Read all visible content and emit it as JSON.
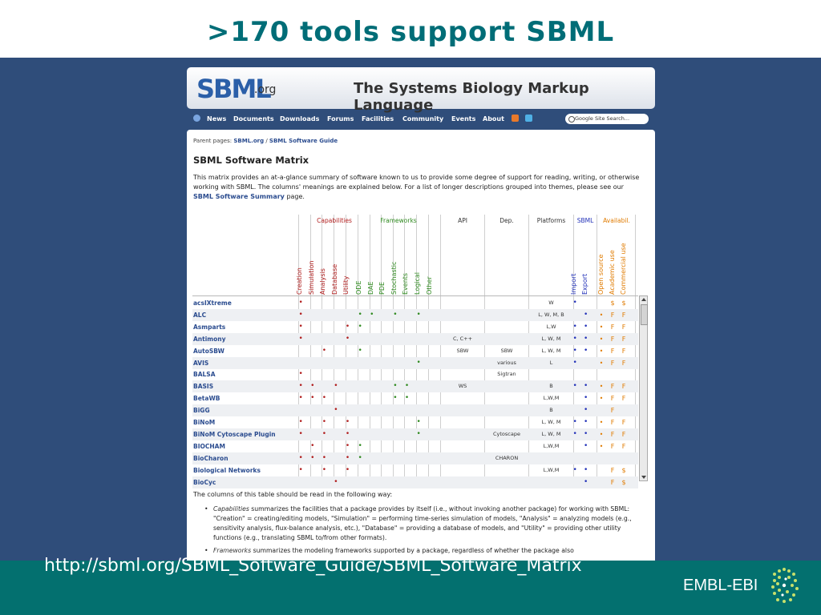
{
  "slide": {
    "title": ">170 tools support SBML",
    "url": "http://sbml.org/SBML_Software_Guide/SBML_Software_Matrix",
    "logo_text": "EMBL-EBI"
  },
  "site": {
    "logo_main": "SBML",
    "logo_suffix": ".org",
    "tagline": "The Systems Biology Markup Language",
    "nav": [
      "News",
      "Documents",
      "Downloads",
      "Forums",
      "Facilities",
      "Community",
      "Events",
      "About"
    ],
    "search_placeholder": "Google Site Search..."
  },
  "page": {
    "crumb_prefix": "Parent pages:",
    "crumb_1": "SBML.org",
    "crumb_sep": "/",
    "crumb_2": "SBML Software Guide",
    "heading": "SBML Software Matrix",
    "intro_1": "This matrix provides an at-a-glance summary of software known to us to provide some degree of support for reading, writing, or otherwise working with SBML. The columns' meanings are explained below. For a list of longer descriptions grouped into themes, please see our",
    "intro_link": "SBML Software Summary",
    "intro_2": "page.",
    "explain": "The columns of this table should be read in the following way:",
    "bullet_1_term": "Capabilities",
    "bullet_1_text": "summarizes the facilities that a package provides by itself (i.e., without invoking another package) for working with SBML: \"Creation\" = creating/editing models, \"Simulation\" = performing time-series simulation of models, \"Analysis\" = analyzing models (e.g., sensitivity analysis, flux-balance analysis, etc.), \"Database\" = providing a database of models, and \"Utility\" = providing other utility functions (e.g., translating SBML to/from other formats).",
    "bullet_2_term": "Frameworks",
    "bullet_2_text": "summarizes the modeling frameworks supported by a package, regardless of whether the package also"
  },
  "matrix": {
    "groups": [
      "Capabilities",
      "Frameworks",
      "API",
      "Dep.",
      "Platforms",
      "SBML",
      "Availabil."
    ],
    "capabilities": [
      "Creation",
      "Simulation",
      "Analysis",
      "Database",
      "Utility"
    ],
    "frameworks": [
      "ODE",
      "DAE",
      "PDE",
      "Stochastic",
      "Events",
      "Logical",
      "Other"
    ],
    "sbml": [
      "Import",
      "Export"
    ],
    "availability": [
      "Open source",
      "Academic use",
      "Commercial use"
    ],
    "colors": {
      "capabilities": "#b01c1c",
      "frameworks": "#2f8a1f",
      "sbml": "#2231b8",
      "availability": "#e07b00",
      "link": "#2b4c8f"
    },
    "rows": [
      {
        "name": "acsIXtreme",
        "cap": [
          1,
          0,
          0,
          0,
          0
        ],
        "fw": [
          0,
          0,
          0,
          0,
          0,
          0,
          0
        ],
        "api": "",
        "dep": "",
        "plat": "W",
        "sbml": [
          1,
          0
        ],
        "avail": [
          "",
          "$",
          "$"
        ]
      },
      {
        "name": "ALC",
        "cap": [
          1,
          0,
          0,
          0,
          0
        ],
        "fw": [
          1,
          1,
          0,
          1,
          0,
          1,
          0
        ],
        "api": "",
        "dep": "",
        "plat": "L, W, M, B",
        "sbml": [
          0,
          1
        ],
        "avail": [
          "•",
          "F",
          "F"
        ]
      },
      {
        "name": "Asmparts",
        "cap": [
          1,
          0,
          0,
          0,
          1
        ],
        "fw": [
          1,
          0,
          0,
          0,
          0,
          0,
          0
        ],
        "api": "",
        "dep": "",
        "plat": "L,W",
        "sbml": [
          1,
          1
        ],
        "avail": [
          "•",
          "F",
          "F"
        ]
      },
      {
        "name": "Antimony",
        "cap": [
          1,
          0,
          0,
          0,
          1
        ],
        "fw": [
          0,
          0,
          0,
          0,
          0,
          0,
          0
        ],
        "api": "C, C++",
        "dep": "",
        "plat": "L, W, M",
        "sbml": [
          1,
          1
        ],
        "avail": [
          "•",
          "F",
          "F"
        ]
      },
      {
        "name": "AutoSBW",
        "cap": [
          0,
          0,
          1,
          0,
          0
        ],
        "fw": [
          1,
          0,
          0,
          0,
          0,
          0,
          0
        ],
        "api": "SBW",
        "dep": "SBW",
        "plat": "L, W, M",
        "sbml": [
          1,
          1
        ],
        "avail": [
          "•",
          "F",
          "F"
        ]
      },
      {
        "name": "AVIS",
        "cap": [
          0,
          0,
          0,
          0,
          0
        ],
        "fw": [
          0,
          0,
          0,
          0,
          0,
          1,
          0
        ],
        "api": "",
        "dep": "various",
        "plat": "L",
        "sbml": [
          1,
          0
        ],
        "avail": [
          "•",
          "F",
          "F"
        ]
      },
      {
        "name": "BALSA",
        "cap": [
          1,
          0,
          0,
          0,
          0
        ],
        "fw": [
          0,
          0,
          0,
          0,
          0,
          0,
          0
        ],
        "api": "",
        "dep": "Sigtran",
        "plat": "",
        "sbml": [
          0,
          0
        ],
        "avail": [
          "",
          "",
          ""
        ]
      },
      {
        "name": "BASIS",
        "cap": [
          1,
          1,
          0,
          1,
          0
        ],
        "fw": [
          0,
          0,
          0,
          1,
          1,
          0,
          0
        ],
        "api": "WS",
        "dep": "",
        "plat": "B",
        "sbml": [
          1,
          1
        ],
        "avail": [
          "•",
          "F",
          "F"
        ]
      },
      {
        "name": "BetaWB",
        "cap": [
          1,
          1,
          1,
          0,
          0
        ],
        "fw": [
          0,
          0,
          0,
          1,
          1,
          0,
          0
        ],
        "api": "",
        "dep": "",
        "plat": "L,W,M",
        "sbml": [
          0,
          1
        ],
        "avail": [
          "•",
          "F",
          "F"
        ]
      },
      {
        "name": "BiGG",
        "cap": [
          0,
          0,
          0,
          1,
          0
        ],
        "fw": [
          0,
          0,
          0,
          0,
          0,
          0,
          0
        ],
        "api": "",
        "dep": "",
        "plat": "B",
        "sbml": [
          0,
          1
        ],
        "avail": [
          "",
          "F",
          ""
        ]
      },
      {
        "name": "BiNoM",
        "cap": [
          1,
          0,
          1,
          0,
          1
        ],
        "fw": [
          0,
          0,
          0,
          0,
          0,
          1,
          0
        ],
        "api": "",
        "dep": "",
        "plat": "L, W, M",
        "sbml": [
          1,
          1
        ],
        "avail": [
          "•",
          "F",
          "F"
        ]
      },
      {
        "name": "BiNoM Cytoscape Plugin",
        "cap": [
          1,
          0,
          1,
          0,
          1
        ],
        "fw": [
          0,
          0,
          0,
          0,
          0,
          1,
          0
        ],
        "api": "",
        "dep": "Cytoscape",
        "plat": "L, W, M",
        "sbml": [
          1,
          1
        ],
        "avail": [
          "•",
          "F",
          "F"
        ]
      },
      {
        "name": "BIOCHAM",
        "cap": [
          0,
          1,
          0,
          0,
          1
        ],
        "fw": [
          1,
          0,
          0,
          0,
          0,
          0,
          0
        ],
        "api": "",
        "dep": "",
        "plat": "L,W,M",
        "sbml": [
          0,
          1
        ],
        "avail": [
          "•",
          "F",
          "F"
        ]
      },
      {
        "name": "BioCharon",
        "cap": [
          1,
          1,
          1,
          0,
          1
        ],
        "fw": [
          1,
          0,
          0,
          0,
          0,
          0,
          0
        ],
        "api": "",
        "dep": "CHARON",
        "plat": "",
        "sbml": [
          0,
          0
        ],
        "avail": [
          "",
          "",
          ""
        ]
      },
      {
        "name": "Biological Networks",
        "cap": [
          1,
          0,
          1,
          0,
          1
        ],
        "fw": [
          0,
          0,
          0,
          0,
          0,
          0,
          0
        ],
        "api": "",
        "dep": "",
        "plat": "L,W,M",
        "sbml": [
          1,
          1
        ],
        "avail": [
          "",
          "F",
          "$"
        ]
      },
      {
        "name": "BioCyc",
        "cap": [
          0,
          0,
          0,
          1,
          0
        ],
        "fw": [
          0,
          0,
          0,
          0,
          0,
          0,
          0
        ],
        "api": "",
        "dep": "",
        "plat": "",
        "sbml": [
          0,
          1
        ],
        "avail": [
          "",
          "F",
          "$"
        ]
      }
    ]
  }
}
